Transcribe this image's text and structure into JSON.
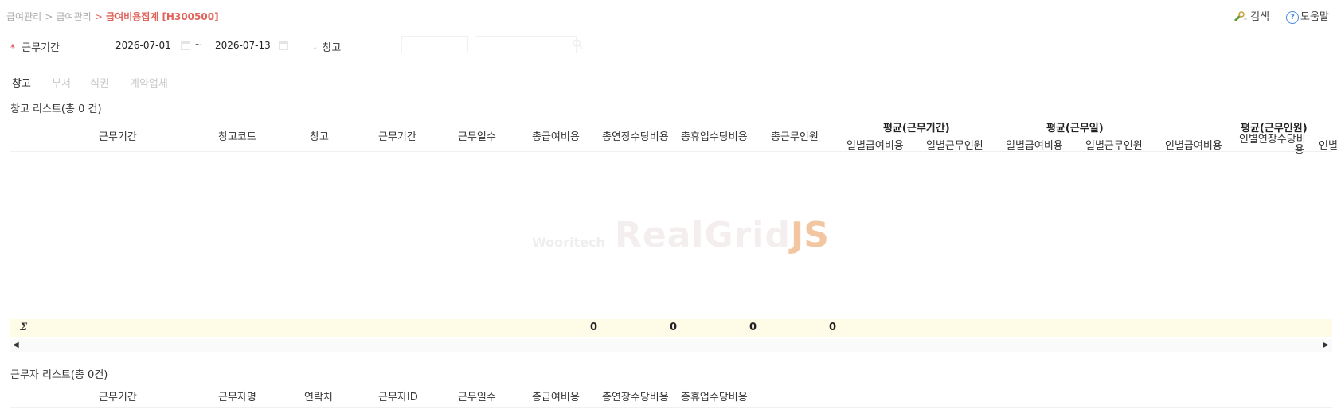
{
  "breadcrumb": {
    "item1": "급여관리",
    "sep1": ">",
    "item2": "급여관리",
    "sep2": ">",
    "current": "급여비용집계 [H300500]"
  },
  "toolbar": {
    "search_label": "검색",
    "help_label": "도움말",
    "help_glyph": "?"
  },
  "search": {
    "period_label": "근무기간",
    "required_mark": "*",
    "date_from": "2026-07-01",
    "tilde": "~",
    "date_to": "2026-07-13",
    "warehouse_label": "창고"
  },
  "tabs": [
    {
      "label": "창고"
    },
    {
      "label": "부서"
    },
    {
      "label": "식권"
    },
    {
      "label": "계약업체"
    }
  ],
  "grid1": {
    "title": "창고 리스트(총 0 건)",
    "headers": {
      "work_period": "근무기간",
      "warehouse_code": "창고코드",
      "warehouse": "창고",
      "work_period2": "근무기간",
      "work_days": "근무일수",
      "total_pay": "총급여비용",
      "total_overtime": "총연장수당비용",
      "total_holiday": "총휴업수당비용",
      "total_workers": "총근무인원"
    },
    "groups": {
      "avg_period": "평균(근무기간)",
      "avg_day": "평균(근무일)",
      "avg_person": "평균(근무인원)"
    },
    "subheaders": {
      "daily_pay_1": "일별급여비용",
      "daily_workers_1": "일별근무인원",
      "daily_pay_2": "일별급여비용",
      "daily_workers_2": "일별근무인원",
      "person_pay": "인별급여비용",
      "person_overtime_a": "인별연장수당비",
      "person_overtime_b": "용",
      "person_cut": "인별"
    },
    "footer": {
      "sigma": "Σ",
      "total_pay": "0",
      "total_overtime": "0",
      "total_holiday": "0",
      "total_workers": "0"
    },
    "scroll_left": "◀",
    "scroll_right": "▶",
    "watermark": {
      "small": "Wooritech",
      "big": "RealGrid",
      "js": "JS"
    }
  },
  "grid2": {
    "title": "근무자 리스트(총 0건)",
    "headers": {
      "work_period": "근무기간",
      "worker_name": "근무자명",
      "contact": "연락처",
      "worker_id": "근무자ID",
      "work_days": "근무일수",
      "total_pay": "총급여비용",
      "total_overtime": "총연장수당비용",
      "total_holiday": "총휴업수당비용"
    }
  }
}
